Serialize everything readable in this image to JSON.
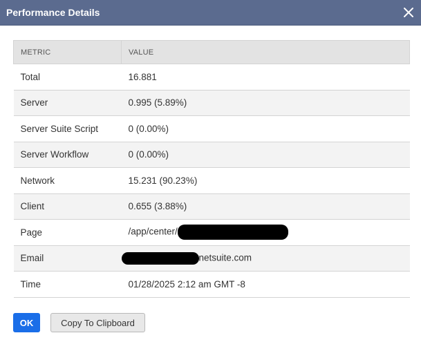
{
  "dialog": {
    "title": "Performance Details",
    "close_icon": "close-icon"
  },
  "table": {
    "headers": [
      "METRIC",
      "VALUE"
    ],
    "rows": [
      {
        "metric": "Total",
        "value": "16.881"
      },
      {
        "metric": "Server",
        "value": "0.995 (5.89%)"
      },
      {
        "metric": "Server Suite Script",
        "value": "0 (0.00%)"
      },
      {
        "metric": "Server Workflow",
        "value": "0 (0.00%)"
      },
      {
        "metric": "Network",
        "value": "15.231 (90.23%)"
      },
      {
        "metric": "Client",
        "value": "0.655 (3.88%)"
      },
      {
        "metric": "Page",
        "value_prefix": "/app/center/"
      },
      {
        "metric": "Email",
        "value_suffix": "netsuite.com"
      },
      {
        "metric": "Time",
        "value": "01/28/2025 2:12 am GMT -8"
      }
    ]
  },
  "buttons": {
    "ok": "OK",
    "copy": "Copy To Clipboard"
  },
  "colors": {
    "titlebar": "#5b6b8f",
    "primary_button": "#1a6ee8"
  }
}
